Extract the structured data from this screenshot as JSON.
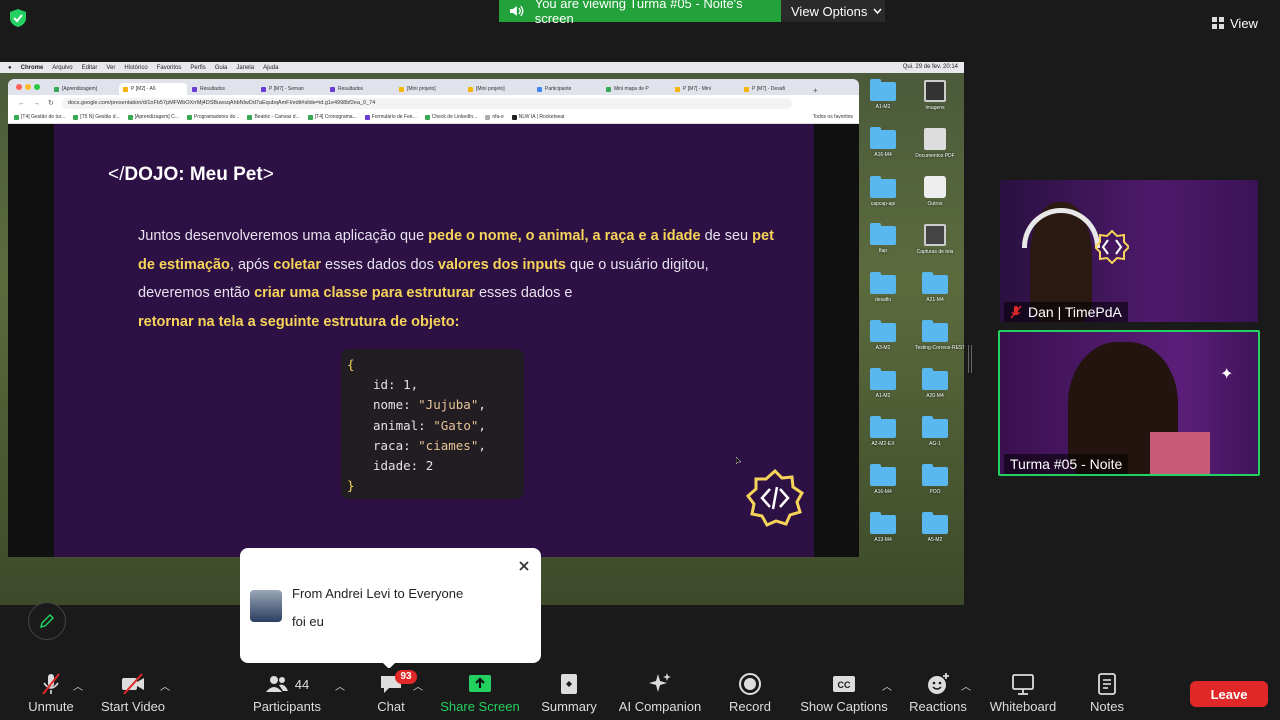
{
  "banner": {
    "text": "You are viewing Turma #05 - Noite's screen",
    "view_options": "View Options"
  },
  "view_button": "View",
  "mac_menu": [
    "Chrome",
    "Arquivo",
    "Editar",
    "Ver",
    "Histórico",
    "Favoritos",
    "Perfis",
    "Guia",
    "Janela",
    "Ajuda"
  ],
  "mac_clock": "Qui. 29 de fev.  20:14",
  "tabs": [
    "[Aprendizagem]",
    "P [M2] - A6",
    "Resultados",
    "P [M7] - Seman",
    "Resultados",
    "[Mini projeto]",
    "[Mini projeto]",
    "Participante",
    "Mini mapa de P",
    "P [M7] - Mini",
    "P [M7] - Desafi"
  ],
  "url": "docs.google.com/presentation/d/1oFb57pMFWbOXrrMj4DSBuwsqAhbNlwDd7aEqubqAmFI/edit#slide=id.g1e4998bf2ea_0_74",
  "bookmarks": [
    "[T4] Gestão de tur...",
    "[T5 N] Gestão d...",
    "[Aprendizagem] C...",
    "Programadores do...",
    "Beatriz - Canvas d...",
    "[T4] Cronograma...",
    "Formulário de Fee...",
    "Check de LinkedIn...",
    "nfa-e",
    "NLW IA | Rocketseat"
  ],
  "bookmarks_all": "Todos os favoritos",
  "slide": {
    "title_bracket_open": "</",
    "title": "DOJO: Meu Pet",
    "title_bracket_close": ">",
    "p1": "Juntos desenvolveremos uma aplicação que ",
    "h1": "pede o nome, o animal, a raça e a idade",
    "p2": " de seu ",
    "h2": "pet de estimação",
    "p3": ", após ",
    "h3": "coletar",
    "p4": " esses dados dos ",
    "h4": "valores  dos inputs",
    "p5": " que o usuário digitou, deveremos então ",
    "h5": "criar uma classe para estruturar",
    "p6": " esses dados e ",
    "h6": "retornar na tela a seguinte estrutura de objeto:",
    "code_open": "{",
    "code_lines": [
      {
        "key": "id: ",
        "val": "1",
        "str": false
      },
      {
        "key": "nome: ",
        "val": "\"Jujuba\"",
        "str": true
      },
      {
        "key": "animal: ",
        "val": "\"Gato\"",
        "str": true
      },
      {
        "key": "raca: ",
        "val": "\"ciames\"",
        "str": true
      },
      {
        "key": "idade: ",
        "val": "2",
        "str": false
      }
    ],
    "code_close": "}"
  },
  "desktop_icons": [
    {
      "label": "A1-M2",
      "type": "folder"
    },
    {
      "label": "Imagens",
      "type": "file"
    },
    {
      "label": "A16-M4",
      "type": "folder"
    },
    {
      "label": "Documentos PDF",
      "type": "file"
    },
    {
      "label": "capcap-api",
      "type": "folder"
    },
    {
      "label": "Outros",
      "type": "file"
    },
    {
      "label": "flap",
      "type": "folder"
    },
    {
      "label": "Capturas de tela",
      "type": "file"
    },
    {
      "label": "desafio",
      "type": "folder"
    },
    {
      "label": "A21-M4",
      "type": "folder"
    },
    {
      "label": "A3-M2",
      "type": "folder"
    },
    {
      "label": "Testing-Correos-REST-API",
      "type": "folder"
    },
    {
      "label": "A1-M2",
      "type": "folder"
    },
    {
      "label": "A20-M4",
      "type": "folder"
    },
    {
      "label": "A2-M2-EX",
      "type": "folder"
    },
    {
      "label": "AG-1",
      "type": "folder"
    },
    {
      "label": "A16-M4",
      "type": "folder"
    },
    {
      "label": "POO",
      "type": "folder"
    },
    {
      "label": "A13-M4",
      "type": "folder"
    },
    {
      "label": "A5-M2",
      "type": "folder"
    }
  ],
  "participants_tiles": [
    {
      "name": "Dan | TimePdA",
      "muted": true
    },
    {
      "name": "Turma #05 - Noite",
      "muted": false
    }
  ],
  "toast": {
    "from": "From Andrei Levi to Everyone",
    "message": "foi eu"
  },
  "toolbar": {
    "unmute": "Unmute",
    "start_video": "Start Video",
    "participants": "Participants",
    "participants_count": "44",
    "chat": "Chat",
    "chat_badge": "93",
    "share_screen": "Share Screen",
    "summary": "Summary",
    "ai_companion": "AI Companion",
    "record": "Record",
    "show_captions": "Show Captions",
    "reactions": "Reactions",
    "whiteboard": "Whiteboard",
    "notes": "Notes",
    "leave": "Leave"
  },
  "colors": {
    "share_green": "#23d160",
    "banner_green": "#23a13b",
    "leave_red": "#e02828",
    "slide_purple": "#2d1044",
    "highlight_yellow": "#f6d45a"
  }
}
